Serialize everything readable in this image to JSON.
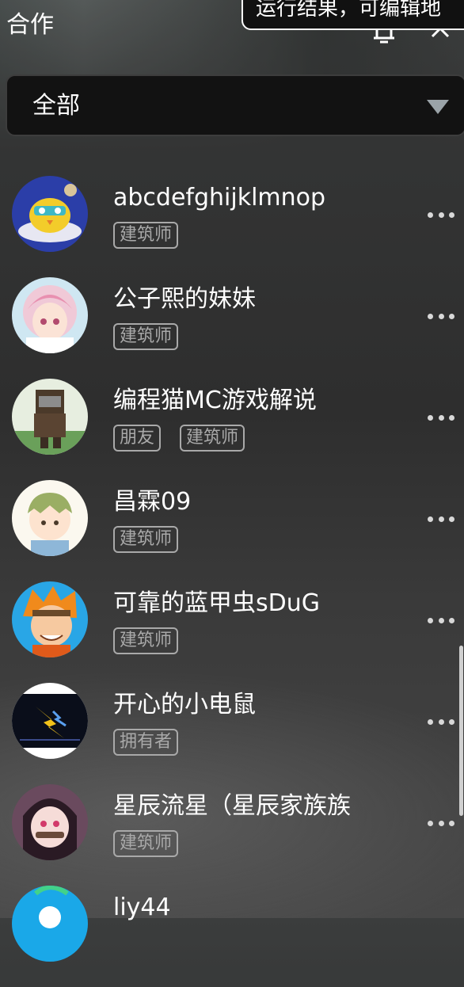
{
  "header": {
    "title": "合作",
    "toast_text": "运行结果，可编辑地"
  },
  "filter": {
    "selected": "全部"
  },
  "members": [
    {
      "name": "abcdefghijklmnop",
      "tags": [
        "建筑师"
      ],
      "avatar": "chick-avatar"
    },
    {
      "name": "公子熙的妹妹",
      "tags": [
        "建筑师"
      ],
      "avatar": "pink-hair-girl-avatar"
    },
    {
      "name": "编程猫MC游戏解说",
      "tags": [
        "朋友",
        "建筑师"
      ],
      "avatar": "pixel-warrior-avatar"
    },
    {
      "name": "昌霖09",
      "tags": [
        "建筑师"
      ],
      "avatar": "green-hair-boy-avatar"
    },
    {
      "name": "可靠的蓝甲虫sDuG",
      "tags": [
        "建筑师"
      ],
      "avatar": "orange-hair-boy-avatar"
    },
    {
      "name": "开心的小电鼠",
      "tags": [
        "拥有者"
      ],
      "avatar": "lightning-avatar"
    },
    {
      "name": "星辰流星（星辰家族族",
      "tags": [
        "建筑师"
      ],
      "avatar": "demon-girl-avatar"
    },
    {
      "name": "liy44",
      "tags": [],
      "avatar": "blue-avatar"
    }
  ],
  "colors": {
    "background": "#333434",
    "tag_border": "#a9a9a9",
    "filter_bg": "#121212"
  }
}
